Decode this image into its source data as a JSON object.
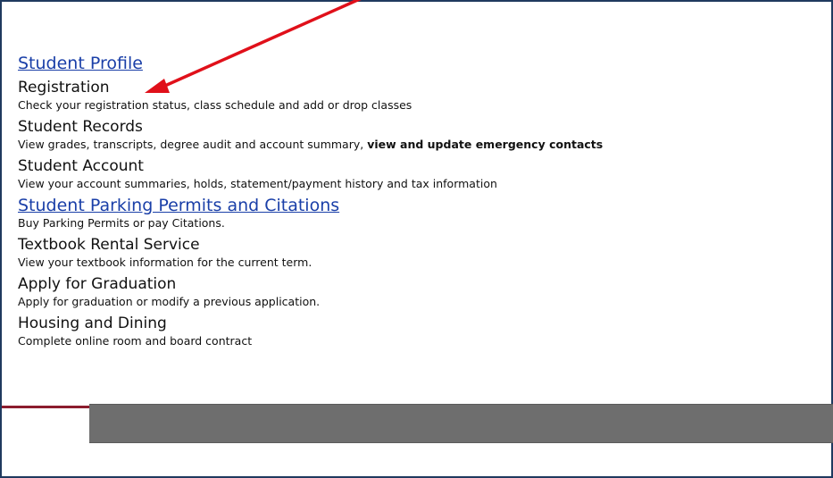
{
  "items": [
    {
      "title": "Student Profile",
      "link": true,
      "desc": ""
    },
    {
      "title": "Registration",
      "link": false,
      "desc": "Check your registration status, class schedule and add or drop classes"
    },
    {
      "title": "Student Records",
      "link": false,
      "desc": "View grades, transcripts, degree audit and account summary, ",
      "desc_bold": "view and update emergency contacts"
    },
    {
      "title": "Student Account",
      "link": false,
      "desc": "View your account summaries, holds, statement/payment history and tax information"
    },
    {
      "title": "Student Parking Permits and Citations",
      "link": true,
      "desc": "Buy Parking Permits or pay Citations."
    },
    {
      "title": "Textbook Rental Service",
      "link": false,
      "desc": "View your textbook information for the current term."
    },
    {
      "title": "Apply for Graduation",
      "link": false,
      "desc": "Apply for graduation or modify a previous application."
    },
    {
      "title": "Housing and Dining",
      "link": false,
      "desc": "Complete online room and board contract"
    }
  ],
  "colors": {
    "link": "#1a3fa8",
    "arrow": "#e0101a",
    "accent_rule": "#8c1c2e",
    "footer_bar": "#6e6e6e",
    "frame": "#1f3a5f"
  }
}
